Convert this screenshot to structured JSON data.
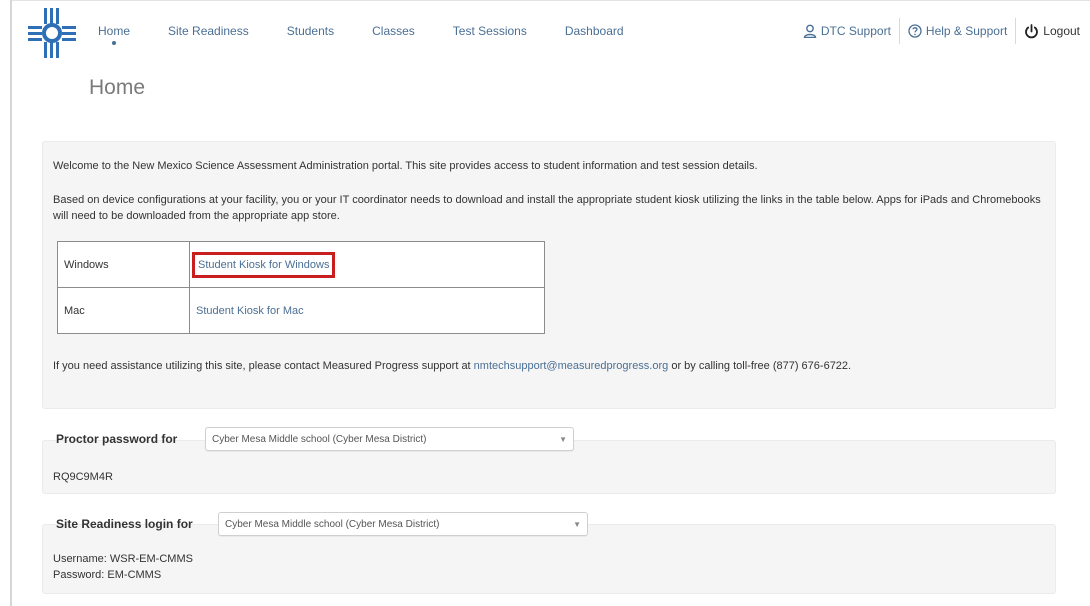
{
  "nav": {
    "items": [
      "Home",
      "Site Readiness",
      "Students",
      "Classes",
      "Test Sessions",
      "Dashboard"
    ],
    "active": "Home"
  },
  "utilities": {
    "dtc_support": "DTC Support",
    "help_support": "Help & Support",
    "logout": "Logout"
  },
  "page": {
    "title": "Home"
  },
  "welcome": {
    "intro": "Welcome to the New Mexico Science Assessment Administration portal. This site provides access to student information and test session details.",
    "kiosk_instructions": "Based on device configurations at your facility, you or your IT coordinator needs to download and install the appropriate student kiosk utilizing the links in the table below. Apps for iPads and Chromebooks will need to be downloaded from the appropriate app store.",
    "kiosks": [
      {
        "os": "Windows",
        "link": "Student Kiosk for Windows"
      },
      {
        "os": "Mac",
        "link": "Student Kiosk for Mac"
      }
    ],
    "assistance_before": "If you need assistance utilizing this site, please contact Measured Progress support at ",
    "support_email": "nmtechsupport@measuredprogress.org",
    "assistance_after": " or by calling toll-free (877) 676-6722."
  },
  "proctor": {
    "label": "Proctor password for",
    "selected_school": "Cyber Mesa Middle school (Cyber Mesa District)",
    "password": "RQ9C9M4R"
  },
  "site_readiness": {
    "label": "Site Readiness login for",
    "selected_school": "Cyber Mesa Middle school (Cyber Mesa District)",
    "username_line": "Username: WSR-EM-CMMS",
    "password_line": "Password: EM-CMMS"
  },
  "colors": {
    "link": "#4a6f95",
    "highlight": "#c81e1e",
    "logo": "#2e6fb5",
    "panel": "#f5f5f5"
  }
}
